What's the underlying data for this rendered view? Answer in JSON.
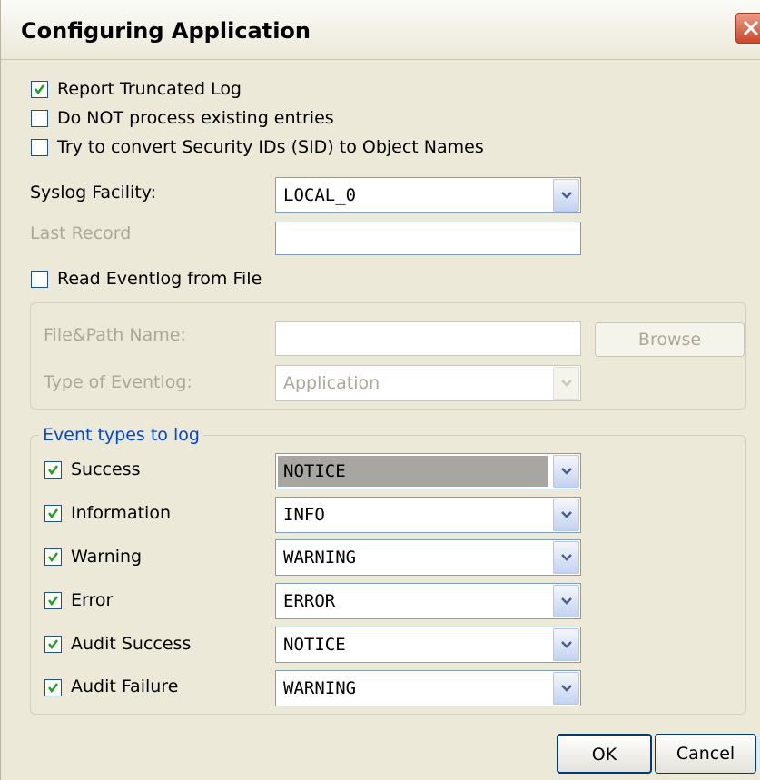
{
  "window": {
    "title": "Configuring Application"
  },
  "options": {
    "report_truncated_log": {
      "label": "Report Truncated Log",
      "checked": true
    },
    "do_not_process": {
      "label": "Do NOT process existing entries",
      "checked": false
    },
    "convert_sid": {
      "label": "Try to convert Security IDs (SID) to Object Names",
      "checked": false
    }
  },
  "syslog_facility": {
    "label": "Syslog Facility:",
    "value": "LOCAL_0"
  },
  "last_record": {
    "label": "Last Record",
    "value": ""
  },
  "read_from_file": {
    "label": "Read Eventlog from File",
    "checked": false,
    "file_path_label": "File&Path Name:",
    "file_path_value": "",
    "browse_label": "Browse",
    "type_label": "Type of Eventlog:",
    "type_value": "Application"
  },
  "event_types": {
    "legend": "Event types to log",
    "rows": [
      {
        "label": "Success",
        "checked": true,
        "value": "NOTICE"
      },
      {
        "label": "Information",
        "checked": true,
        "value": "INFO"
      },
      {
        "label": "Warning",
        "checked": true,
        "value": "WARNING"
      },
      {
        "label": "Error",
        "checked": true,
        "value": "ERROR"
      },
      {
        "label": "Audit Success",
        "checked": true,
        "value": "NOTICE"
      },
      {
        "label": "Audit Failure",
        "checked": true,
        "value": "WARNING"
      }
    ]
  },
  "buttons": {
    "ok": "OK",
    "cancel": "Cancel"
  },
  "colors": {
    "accent": "#0046d5",
    "checkmark": "#21a121",
    "close": "#c9472a"
  }
}
